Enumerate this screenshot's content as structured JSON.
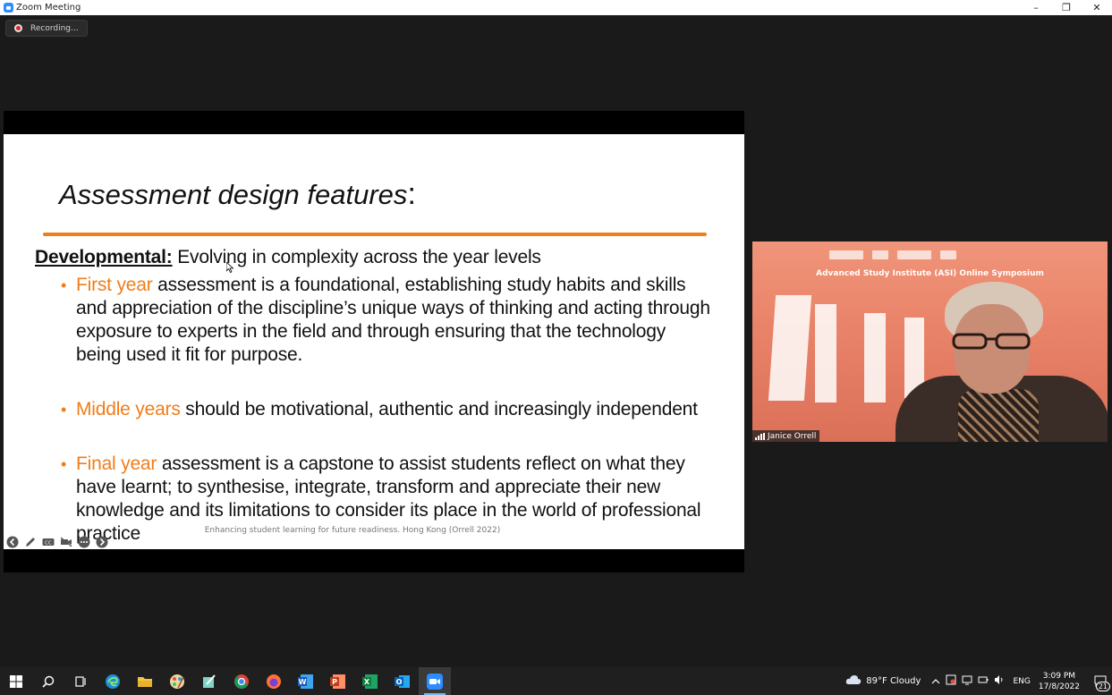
{
  "window": {
    "title": "Zoom Meeting",
    "controls": {
      "minimize": "–",
      "restore": "❐",
      "close": "✕"
    }
  },
  "recording": {
    "label": "Recording..."
  },
  "slide": {
    "title": "Assessment design features",
    "title_colon": ":",
    "developmental_label": "Developmental:",
    "developmental_text": " Evolving in complexity across the year levels",
    "bullets": [
      {
        "highlight": "First year",
        "text": " assessment is a foundational, establishing study habits and skills and appreciation of the discipline’s unique ways of thinking and acting through exposure to experts in the field and through ensuring that the technology being used it fit for purpose."
      },
      {
        "highlight": "Middle years",
        "text": " should be motivational, authentic and increasingly independent"
      },
      {
        "highlight": "Final year",
        "text": " assessment is a capstone to assist students reflect on what they have learnt; to synthesise, integrate, transform and appreciate their new knowledge and its limitations to consider its place in the world of professional practice"
      }
    ],
    "bullet_symbol": "•",
    "footer": "Enhancing student learning for future readiness. Hong Kong (Orrell 2022)",
    "accent_color": "#f07d1a",
    "toolbar_icons": [
      "back-arrow-icon",
      "pen-icon",
      "captions-icon",
      "video-off-icon",
      "more-icon",
      "forward-arrow-icon"
    ]
  },
  "video": {
    "banner": "Advanced Study Institute (ASI) Online Symposium",
    "participant_name": "Janice Orrell"
  },
  "taskbar": {
    "apps": [
      "windows-start-icon",
      "search-icon",
      "task-view-icon",
      "edge-icon",
      "file-explorer-icon",
      "paint-icon",
      "sticky-notes-icon",
      "chrome-icon",
      "firefox-icon",
      "word-icon",
      "powerpoint-icon",
      "excel-icon",
      "outlook-icon",
      "zoom-icon"
    ],
    "weather": "89°F  Cloudy",
    "language": "ENG",
    "time": "3:09 PM",
    "date": "17/8/2022",
    "notification_count": "21"
  }
}
